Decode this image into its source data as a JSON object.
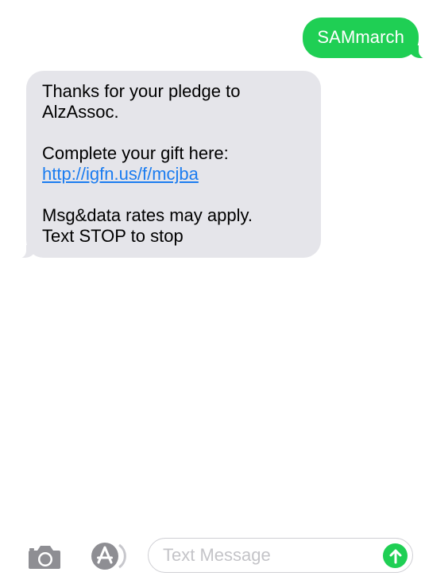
{
  "conversation": {
    "sent": {
      "text": "SAMmarch",
      "color": "#1fcf54"
    },
    "received": {
      "line1": "Thanks for your pledge to",
      "line2": "AlzAssoc.",
      "line3": "Complete your gift here:",
      "link": "http://igfn.us/f/mcjba",
      "line4": "Msg&data rates may apply.",
      "line5": "Text STOP to stop",
      "color": "#e5e5ea",
      "link_color": "#1b7cf0"
    }
  },
  "composer": {
    "camera_icon": "camera-icon",
    "apps_icon": "app-store-icon",
    "placeholder": "Text Message",
    "value": "",
    "send_icon": "send-arrow-icon"
  }
}
